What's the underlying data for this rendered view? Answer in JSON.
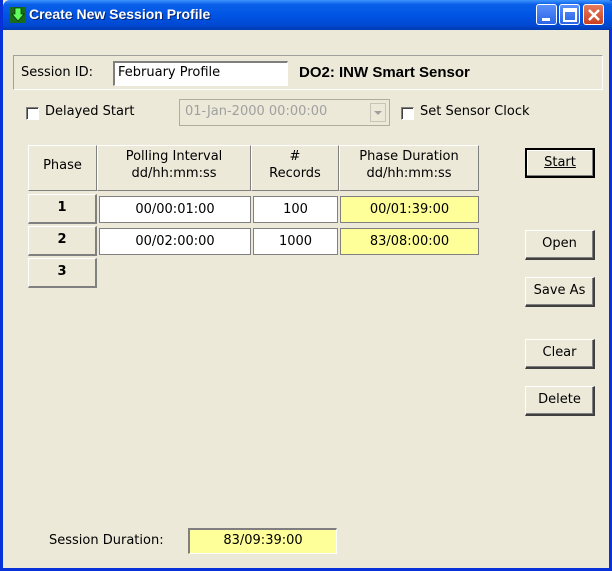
{
  "window": {
    "title": "Create New Session Profile",
    "icon": "download-arrow-icon",
    "controls": [
      "minimize-icon",
      "maximize-icon",
      "close-icon"
    ]
  },
  "session": {
    "label": "Session ID:",
    "value": "February Profile",
    "sensor": "DO2: INW Smart Sensor"
  },
  "options": {
    "delayed_start_label": "Delayed Start",
    "delayed_start_checked": false,
    "start_date": "01-Jan-2000 00:00:00",
    "start_date_enabled": false,
    "set_clock_label": "Set Sensor Clock",
    "set_clock_checked": false
  },
  "grid": {
    "headers": {
      "phase": "Phase",
      "polling_line1": "Polling Interval",
      "polling_line2": "dd/hh:mm:ss",
      "records_line1": "#",
      "records_line2": "Records",
      "duration_line1": "Phase Duration",
      "duration_line2": "dd/hh:mm:ss"
    },
    "rows": [
      {
        "phase": "1",
        "polling": "00/00:01:00",
        "records": "100",
        "duration": "00/01:39:00"
      },
      {
        "phase": "2",
        "polling": "00/02:00:00",
        "records": "1000",
        "duration": "83/08:00:00"
      },
      {
        "phase": "3"
      }
    ]
  },
  "buttons": {
    "start": "Start",
    "open": "Open",
    "save_as": "Save As",
    "clear": "Clear",
    "delete": "Delete"
  },
  "footer": {
    "label": "Session Duration:",
    "value": "83/09:39:00"
  },
  "colors": {
    "titlebar": "#0055e5",
    "highlight_field": "#ffff99",
    "face": "#ece9d8"
  }
}
